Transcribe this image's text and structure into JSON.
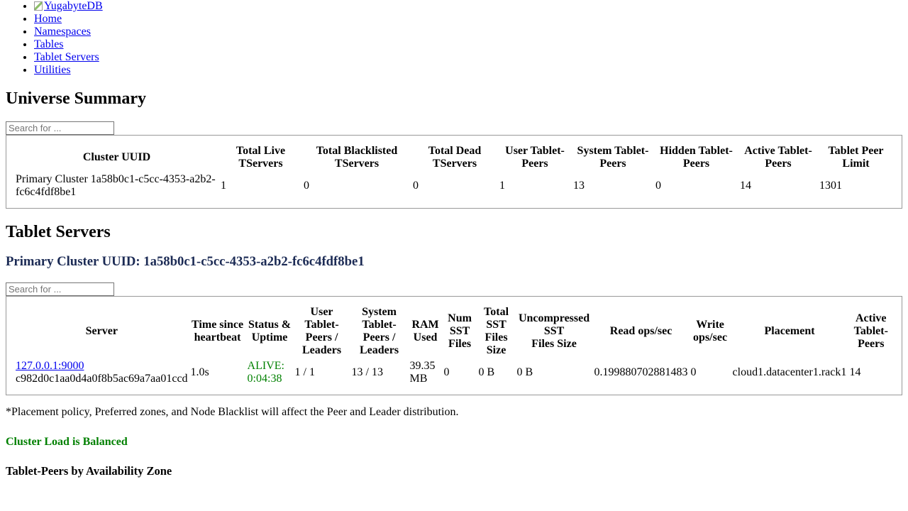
{
  "nav": {
    "logo_alt": "YugabyteDB",
    "items": [
      {
        "label": "Home"
      },
      {
        "label": "Namespaces"
      },
      {
        "label": "Tables"
      },
      {
        "label": "Tablet Servers"
      },
      {
        "label": "Utilities"
      }
    ]
  },
  "universe": {
    "title": "Universe Summary",
    "search_placeholder": "Search for ...",
    "headers": [
      "Cluster UUID",
      "Total Live TServers",
      "Total Blacklisted TServers",
      "Total Dead TServers",
      "User Tablet-Peers",
      "System Tablet-Peers",
      "Hidden Tablet-Peers",
      "Active Tablet-Peers",
      "Tablet Peer Limit"
    ],
    "row": {
      "cluster_uuid": "Primary Cluster 1a58b0c1-c5cc-4353-a2b2-fc6c4fdf8be1",
      "live": "1",
      "blacklisted": "0",
      "dead": "0",
      "user_peers": "1",
      "system_peers": "13",
      "hidden_peers": "0",
      "active_peers": "14",
      "peer_limit": "1301"
    }
  },
  "tservers": {
    "title": "Tablet Servers",
    "cluster_heading": "Primary Cluster UUID: 1a58b0c1-c5cc-4353-a2b2-fc6c4fdf8be1",
    "search_placeholder": "Search for ...",
    "headers": {
      "server": "Server",
      "heartbeat_1": "Time since",
      "heartbeat_2": "heartbeat",
      "status_1": "Status &",
      "status_2": "Uptime",
      "user_1": "User",
      "user_2": "Tablet-",
      "user_3": "Peers /",
      "user_4": "Leaders",
      "system_1": "System",
      "system_2": "Tablet-",
      "system_3": "Peers /",
      "system_4": "Leaders",
      "ram_1": "RAM",
      "ram_2": "Used",
      "numsst_1": "Num",
      "numsst_2": "SST",
      "numsst_3": "Files",
      "totalsst_1": "Total",
      "totalsst_2": "SST",
      "totalsst_3": "Files",
      "totalsst_4": "Size",
      "uncomp_1": "Uncompressed",
      "uncomp_2": "SST",
      "uncomp_3": "Files Size",
      "read": "Read ops/sec",
      "write_1": "Write",
      "write_2": "ops/sec",
      "placement": "Placement",
      "active_1": "Active",
      "active_2": "Tablet-",
      "active_3": "Peers"
    },
    "row": {
      "server_link": "127.0.0.1:9000",
      "server_id": "c982d0c1aa0d4a0f8b5ac69a7aa01ccd",
      "heartbeat": "1.0s",
      "status_1": "ALIVE:",
      "status_2": "0:04:38",
      "user_peers": "1 / 1",
      "system_peers": "13 / 13",
      "ram_1": "39.35",
      "ram_2": "MB",
      "num_sst": "0",
      "total_sst": "0 B",
      "uncompressed": "0 B",
      "read_ops": "0.199880702881483",
      "write_ops": "0",
      "placement": "cloud1.datacenter1.rack1",
      "active_peers": "14"
    }
  },
  "note": "*Placement policy, Preferred zones, and Node Blacklist will affect the Peer and Leader distribution.",
  "balanced": "Cluster Load is Balanced",
  "by_zone_title": "Tablet-Peers by Availability Zone",
  "colors": {
    "link": "#0000ee",
    "status_ok": "#008000",
    "cluster_heading": "#1c2b55"
  }
}
